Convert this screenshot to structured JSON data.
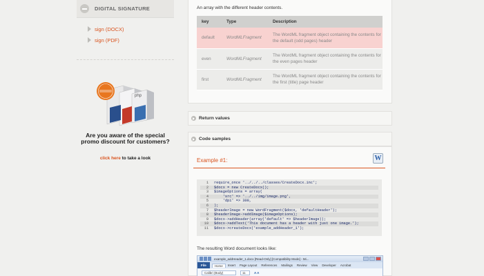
{
  "sidebar": {
    "section_title": "DIGITAL SIGNATURE",
    "links": [
      "sign (DOCX)",
      "sign (PDF)"
    ],
    "promo": {
      "badge": "special promotion",
      "question": "Are you aware of the special promo discount for customers?",
      "link_label": "click here",
      "link_suffix": "to take a look"
    }
  },
  "parameter": {
    "description": "An array with the different header contents.",
    "table": {
      "headers": [
        "key",
        "Type",
        "Description"
      ],
      "rows": [
        {
          "key": "default",
          "type": "WordMLFragment",
          "description": "The WordML fragment object containing the contents for the default (odd pages) header"
        },
        {
          "key": "even",
          "type": "WordMLFragment",
          "description": "The WordML fragment object containing the contents for the even pages header"
        },
        {
          "key": "first",
          "type": "WordMLFragment",
          "description": "The WordML fragment object containing the contents for the first (title) page header"
        }
      ]
    }
  },
  "sections": {
    "return_values": "Return values",
    "code_samples": "Code samples"
  },
  "example": {
    "title": "Example #1:",
    "code": [
      {
        "n": "1",
        "text": "require_once '../../../classes/CreateDocx.inc';"
      },
      {
        "n": "2",
        "text": "$docx = new CreateDocx();"
      },
      {
        "n": "3",
        "text": "$imageOptions = array("
      },
      {
        "n": "4",
        "text": "    'src' => '../../img/image.png',"
      },
      {
        "n": "5",
        "text": "    'dpi' => 300,"
      },
      {
        "n": "6",
        "text": ");"
      },
      {
        "n": "7",
        "text": "$headerImage = new WordFragment($docx, 'defaultHeader');"
      },
      {
        "n": "8",
        "text": "$headerImage->addImage($imageOptions);"
      },
      {
        "n": "9",
        "text": "$docx->addHeader(array('default' => $headerImage));"
      },
      {
        "n": "10",
        "text": "$docx->addText('This document has a header with just one image.');"
      },
      {
        "n": "11",
        "text": "$docx->createDocx('example_addHeader_1');"
      }
    ],
    "result_label": "The resulting Word document looks like:"
  },
  "word_screenshot": {
    "title": "example_addHeader_1.docx [Read-Only] [Compatibility Mode] - Mi...",
    "file_tab": "File",
    "tabs": [
      "Home",
      "Insert",
      "Page Layout",
      "References",
      "Mailings",
      "Review",
      "View",
      "Developer",
      "Acrobat"
    ],
    "font_name": "Calibri (Body)",
    "font_size": "11"
  },
  "colors": {
    "accent": "#d9531e",
    "highlight_row": "#f8d2d0"
  }
}
